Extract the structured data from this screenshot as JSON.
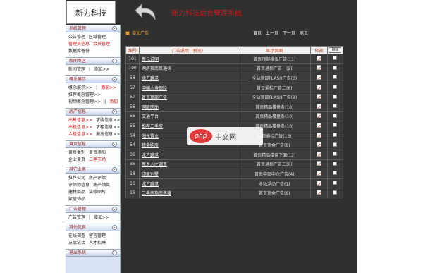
{
  "header": {
    "brand": "新力科技",
    "system_title": "新力科技后台管理系统"
  },
  "sidebar": {
    "sections": [
      {
        "title": "系统管理",
        "rows": [
          [
            {
              "t": "公告管理"
            },
            {
              "t": "区域管理"
            }
          ],
          [
            {
              "t": "管理员信息",
              "red": true
            },
            {
              "t": "会员管理",
              "red": true
            }
          ],
          [
            {
              "t": "数据库备份"
            }
          ]
        ]
      },
      {
        "title": "新闻专区",
        "rows": [
          [
            {
              "t": "新闻管理"
            },
            {
              "t": "|",
              "sep": true
            },
            {
              "t": "添加>>"
            }
          ]
        ]
      },
      {
        "title": "概念展示",
        "rows": [
          [
            {
              "t": "概念展示>>"
            },
            {
              "t": "|",
              "sep": true
            },
            {
              "t": "添加>>",
              "red": true
            }
          ],
          [
            {
              "t": "推荐概念管理>>"
            }
          ],
          [
            {
              "t": "视频概念管理>>"
            },
            {
              "t": "|",
              "sep": true
            },
            {
              "t": "添加",
              "red": true
            }
          ]
        ]
      },
      {
        "title": "房产信息",
        "rows": [
          [
            {
              "t": "出售信息>>",
              "red": true
            },
            {
              "t": "求购信息>>"
            }
          ],
          [
            {
              "t": "出租信息>>",
              "red": true
            },
            {
              "t": "求租信息>>"
            }
          ],
          [
            {
              "t": "合租信息>>",
              "red": true
            },
            {
              "t": "搬房信息>>"
            }
          ]
        ]
      },
      {
        "title": "黄页信息",
        "rows": [
          [
            {
              "t": "黄页类别"
            },
            {
              "t": "黄页添加"
            }
          ],
          [
            {
              "t": "企业黄页"
            },
            {
              "t": "二手市场",
              "red": true
            }
          ]
        ]
      },
      {
        "title": "其它业务",
        "rows": [
          [
            {
              "t": "推荐公司"
            },
            {
              "t": "房产评估"
            }
          ],
          [
            {
              "t": "评估师信息"
            },
            {
              "t": "房产领英"
            }
          ],
          [
            {
              "t": "建材商品"
            },
            {
              "t": "装修图片"
            }
          ],
          [
            {
              "t": "家居饰品"
            }
          ]
        ]
      },
      {
        "title": "广告管理",
        "rows": [
          [
            {
              "t": "广告管理"
            },
            {
              "t": "|",
              "sep": true
            },
            {
              "t": "增加>>"
            }
          ]
        ]
      },
      {
        "title": "其他信息",
        "rows": [
          [
            {
              "t": "在线调查"
            },
            {
              "t": "留言管理"
            }
          ],
          [
            {
              "t": "友情链接"
            },
            {
              "t": "人才招聘"
            }
          ]
        ]
      },
      {
        "title": "退出系统",
        "rows": []
      }
    ]
  },
  "toolbar": {
    "add_label": "增加广告",
    "pager": [
      "首页",
      "上一页",
      "下一页",
      "尾页"
    ]
  },
  "table": {
    "headers": {
      "id": "编号",
      "desc": "广告说明（预览）",
      "page": "显示页面",
      "edit": "修改",
      "delete": "删除"
    },
    "rows": [
      {
        "id": "101",
        "desc": "新元说明",
        "page": "首页顶部横条广告(11)"
      },
      {
        "id": "100",
        "desc": "购房指南页通栏",
        "page": "首页通栏广告一(2)"
      },
      {
        "id": "58",
        "desc": "北方跳求",
        "page": "全站顶部FLASH广告(0)"
      },
      {
        "id": "57",
        "desc": "中国人寿保险",
        "page": "首页通栏广告二(6)"
      },
      {
        "id": "57",
        "desc": "首页顶部广告",
        "page": "全站顶部FLASH广告(9)"
      },
      {
        "id": "56",
        "desc": "网联医助",
        "page": "首页精品楼盘条(10)"
      },
      {
        "id": "55",
        "desc": "交通平台",
        "page": "首页精品楼盘条(10)"
      },
      {
        "id": "55",
        "desc": "推荐二手房",
        "page": "首页精品楼盘条(10)"
      },
      {
        "id": "54",
        "desc": "阳光置业",
        "page": "底部通栏广告(13)"
      },
      {
        "id": "54",
        "desc": "我会购房",
        "page": "首页宽金广告(8)"
      },
      {
        "id": "36",
        "desc": "北方跳求",
        "page": "首页精品楼盘下面(12)"
      },
      {
        "id": "35",
        "desc": "新乡人才调查",
        "page": "首页通栏广告二(6)"
      },
      {
        "id": "18",
        "desc": "印象别墅",
        "page": "首页中部中介广告(4)"
      },
      {
        "id": "16",
        "desc": "北方跳求",
        "page": "全站浮动广告(1)"
      },
      {
        "id": "15",
        "desc": "二手房指南连接",
        "page": "首页宽金广告(8)"
      }
    ]
  },
  "watermark": {
    "logo": "php",
    "text": "中文网"
  }
}
